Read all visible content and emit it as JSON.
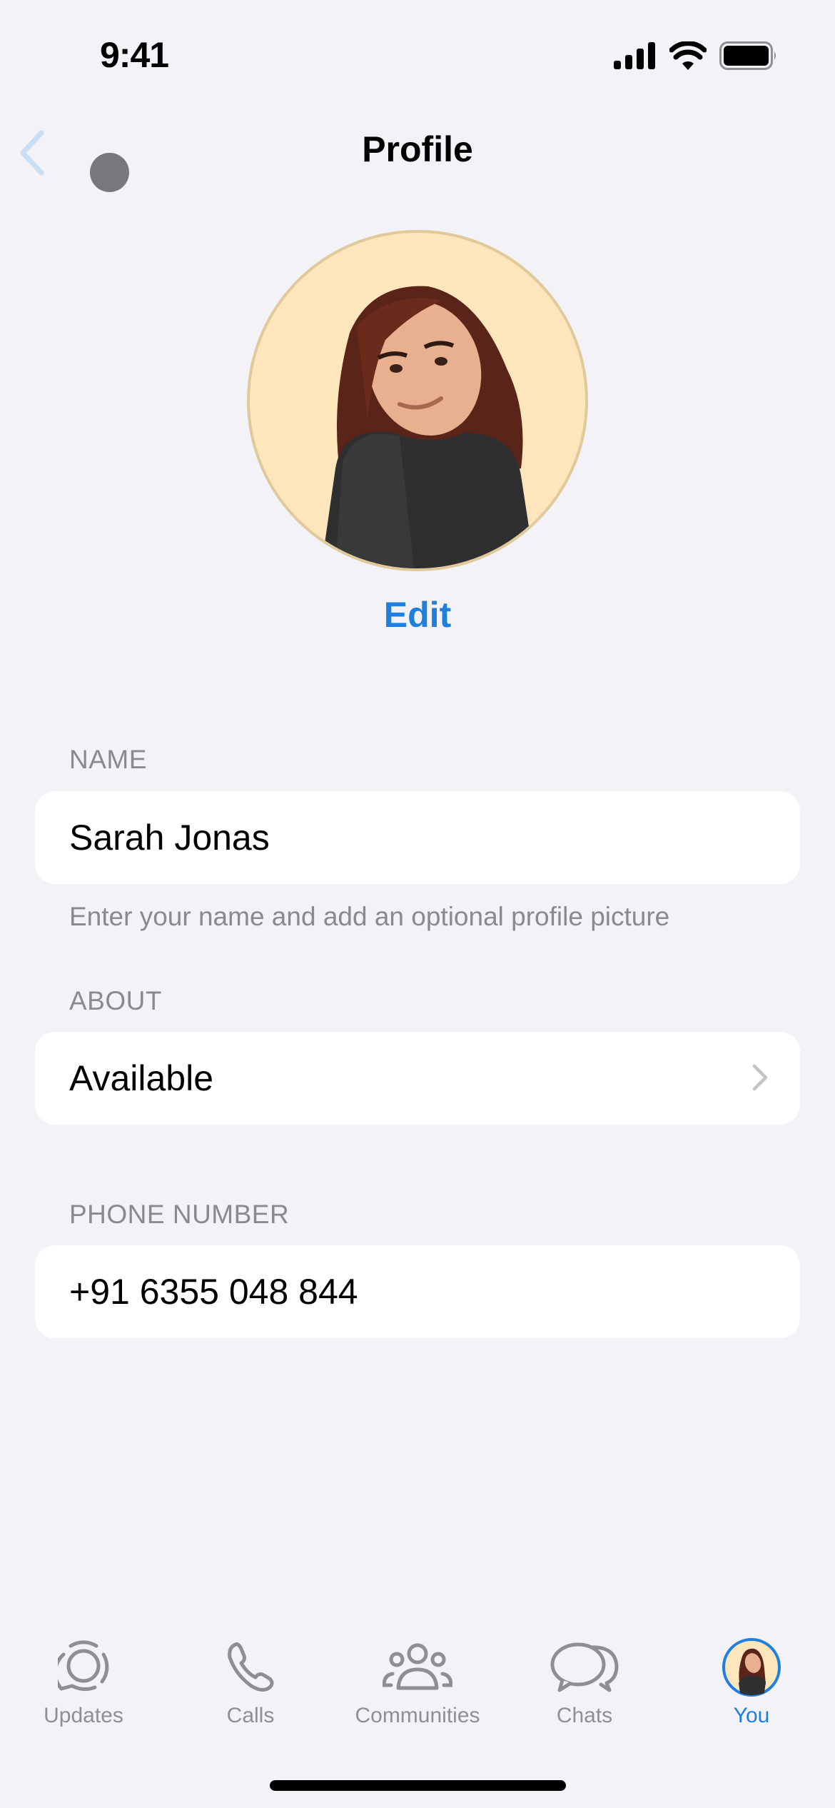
{
  "status_bar": {
    "time": "9:41"
  },
  "nav": {
    "title": "Profile",
    "back_icon": "chevron-left-icon"
  },
  "profile": {
    "edit_label": "Edit"
  },
  "sections": {
    "name": {
      "label": "NAME",
      "value": "Sarah Jonas",
      "hint": "Enter your name and add an optional profile picture"
    },
    "about": {
      "label": "ABOUT",
      "value": "Available"
    },
    "phone": {
      "label": "PHONE NUMBER",
      "value": "+91 6355 048 844"
    }
  },
  "tabbar": {
    "items": [
      {
        "label": "Updates",
        "icon": "updates-icon"
      },
      {
        "label": "Calls",
        "icon": "phone-icon"
      },
      {
        "label": "Communities",
        "icon": "communities-icon"
      },
      {
        "label": "Chats",
        "icon": "chats-icon"
      },
      {
        "label": "You",
        "icon": "avatar",
        "active": true
      }
    ]
  },
  "colors": {
    "accent": "#1E7FDF",
    "background": "#F2F2F7",
    "secondary_text": "#8A8A8E",
    "avatar_bg": "#FDE6BC"
  }
}
